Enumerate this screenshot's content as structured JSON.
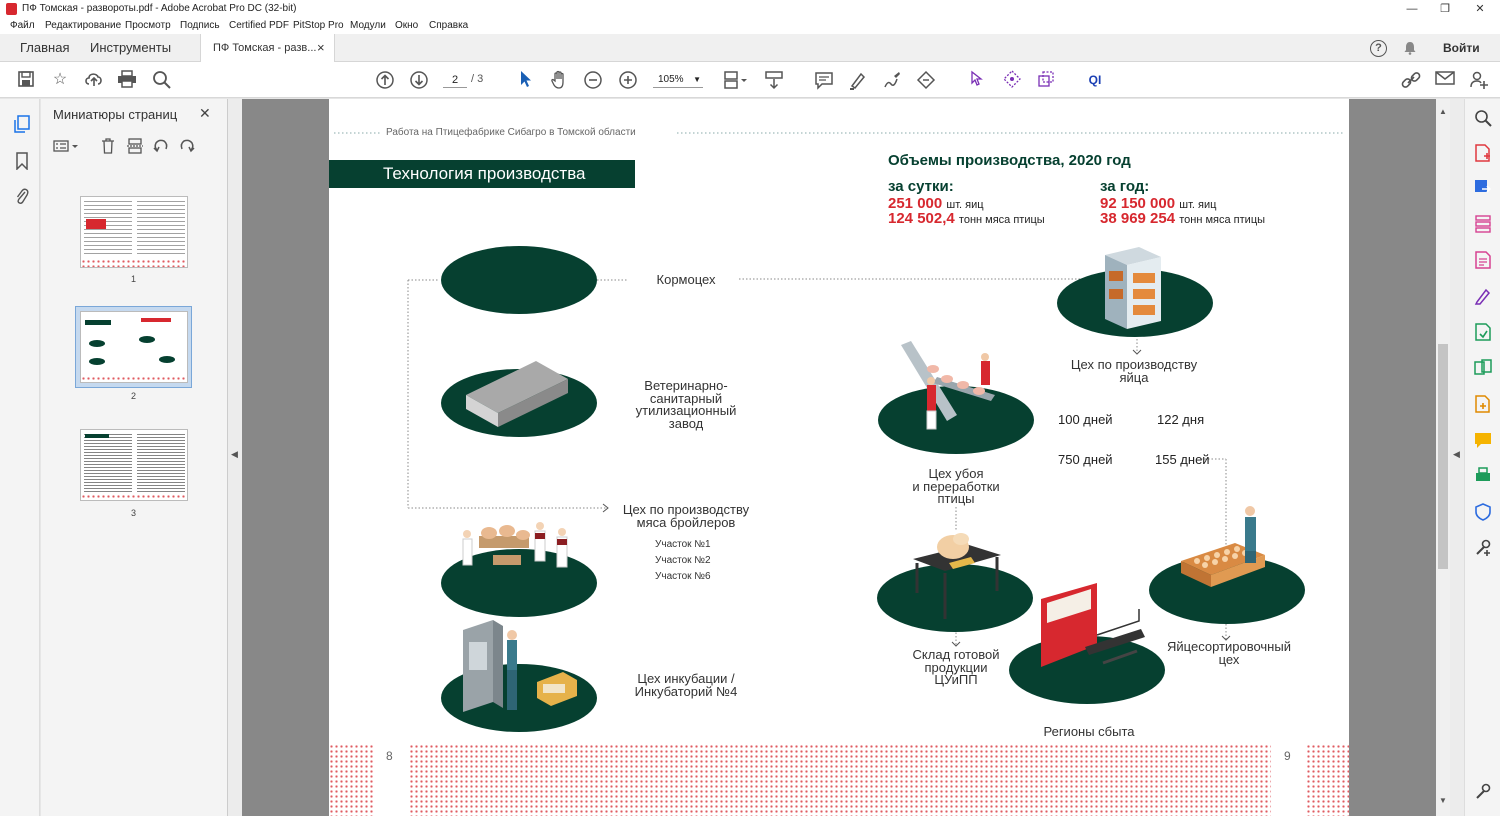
{
  "window": {
    "title": "ПФ Томская - развороты.pdf - Adobe Acrobat Pro DC (32-bit)",
    "minimize": "—",
    "maximize": "❐",
    "close": "✕"
  },
  "menu": [
    "Файл",
    "Редактирование",
    "Просмотр",
    "Подпись",
    "Certified PDF",
    "PitStop Pro",
    "Модули",
    "Окно",
    "Справка"
  ],
  "tabs": {
    "home": "Главная",
    "tools": "Инструменты",
    "doc": "ПФ Томская - разв...",
    "doc_close": "×",
    "help": "?",
    "login": "Войти"
  },
  "toolbar": {
    "page_current": "2",
    "page_total": "/ 3",
    "zoom": "105%"
  },
  "thumbnails": {
    "title": "Миниатюры страниц",
    "close": "✕",
    "pages": [
      "1",
      "2",
      "3"
    ],
    "selected_index": 1
  },
  "page": {
    "header": "Работа на Птицефабрике Сибагро в Томской области",
    "section_title": "Технология производства",
    "volumes_title": "Объемы производства, 2020 год",
    "per_day": {
      "label": "за сутки:",
      "eggs_value": "251 000",
      "eggs_unit": "шт. яиц",
      "meat_value": "124 502,4",
      "meat_unit": "тонн мяса птицы"
    },
    "per_year": {
      "label": "за год:",
      "eggs_value": "92 150 000",
      "eggs_unit": "шт. яиц",
      "meat_value": "38 969 254",
      "meat_unit": "тонн мяса птицы"
    },
    "nodes": {
      "feed": "Кормоцех",
      "vet": "Ветеринарно-\nсанитарный\nутилизационный\nзавод",
      "broiler": "Цех по производству\nмяса бройлеров",
      "sites": [
        "Участок №1",
        "Участок №2",
        "Участок №6"
      ],
      "incubation": "Цех инкубации /\nИнкубаторий №4",
      "egg_shop": "Цех по производству\nяйца",
      "slaughter": "Цех убоя\nи переработки\nптицы",
      "warehouse": "Склад готовой\nпродукции\nЦУиПП",
      "sorting": "Яйцесортировочный\nцех",
      "regions": "Регионы сбыта"
    },
    "days": [
      "100 дней",
      "122 дня",
      "750 дней",
      "155 дней"
    ],
    "page_left": "8",
    "page_right": "9"
  },
  "colors": {
    "dark_green": "#064030",
    "red": "#d7282f"
  }
}
